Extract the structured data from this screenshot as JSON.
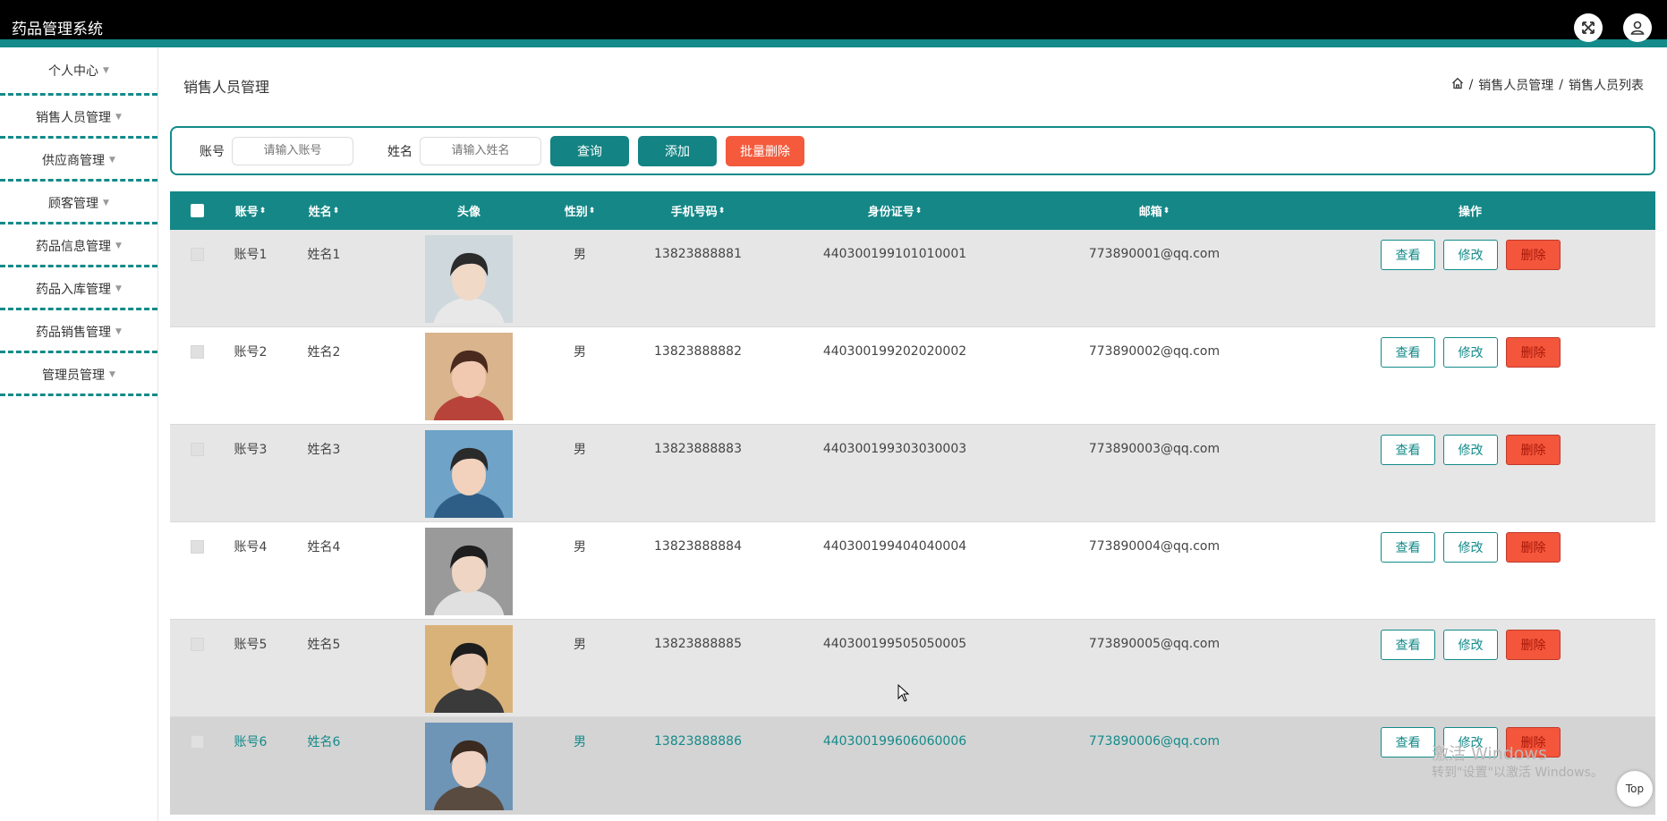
{
  "app": {
    "title": "药品管理系统"
  },
  "sidebar": {
    "items": [
      {
        "label": "个人中心"
      },
      {
        "label": "销售人员管理"
      },
      {
        "label": "供应商管理"
      },
      {
        "label": "顾客管理"
      },
      {
        "label": "药品信息管理"
      },
      {
        "label": "药品入库管理"
      },
      {
        "label": "药品销售管理"
      },
      {
        "label": "管理员管理"
      }
    ]
  },
  "page": {
    "title": "销售人员管理"
  },
  "breadcrumb": {
    "level1": "销售人员管理",
    "level2": "销售人员列表",
    "sep": "/"
  },
  "search": {
    "account_label": "账号",
    "account_placeholder": "请输入账号",
    "name_label": "姓名",
    "name_placeholder": "请输入姓名",
    "query_label": "查询",
    "add_label": "添加",
    "batch_delete_label": "批量删除"
  },
  "table": {
    "headers": {
      "account": "账号",
      "name": "姓名",
      "avatar": "头像",
      "gender": "性别",
      "phone": "手机号码",
      "idcard": "身份证号",
      "email": "邮箱",
      "actions": "操作"
    },
    "action_labels": {
      "view": "查看",
      "edit": "修改",
      "delete": "删除"
    },
    "rows": [
      {
        "account": "账号1",
        "name": "姓名1",
        "gender": "男",
        "phone": "13823888881",
        "idcard": "440300199101010001",
        "email": "773890001@qq.com"
      },
      {
        "account": "账号2",
        "name": "姓名2",
        "gender": "男",
        "phone": "13823888882",
        "idcard": "440300199202020002",
        "email": "773890002@qq.com"
      },
      {
        "account": "账号3",
        "name": "姓名3",
        "gender": "男",
        "phone": "13823888883",
        "idcard": "440300199303030003",
        "email": "773890003@qq.com"
      },
      {
        "account": "账号4",
        "name": "姓名4",
        "gender": "男",
        "phone": "13823888884",
        "idcard": "440300199404040004",
        "email": "773890004@qq.com"
      },
      {
        "account": "账号5",
        "name": "姓名5",
        "gender": "男",
        "phone": "13823888885",
        "idcard": "440300199505050005",
        "email": "773890005@qq.com"
      },
      {
        "account": "账号6",
        "name": "姓名6",
        "gender": "男",
        "phone": "13823888886",
        "idcard": "440300199606060006",
        "email": "773890006@qq.com"
      }
    ]
  },
  "overlay": {
    "watermark_line1": "激活 Windows",
    "watermark_line2": "转到\"设置\"以激活 Windows。",
    "top_label": "Top"
  },
  "colors": {
    "accent": "#148a8a",
    "danger": "#f4563b",
    "header_bg": "#000000"
  }
}
